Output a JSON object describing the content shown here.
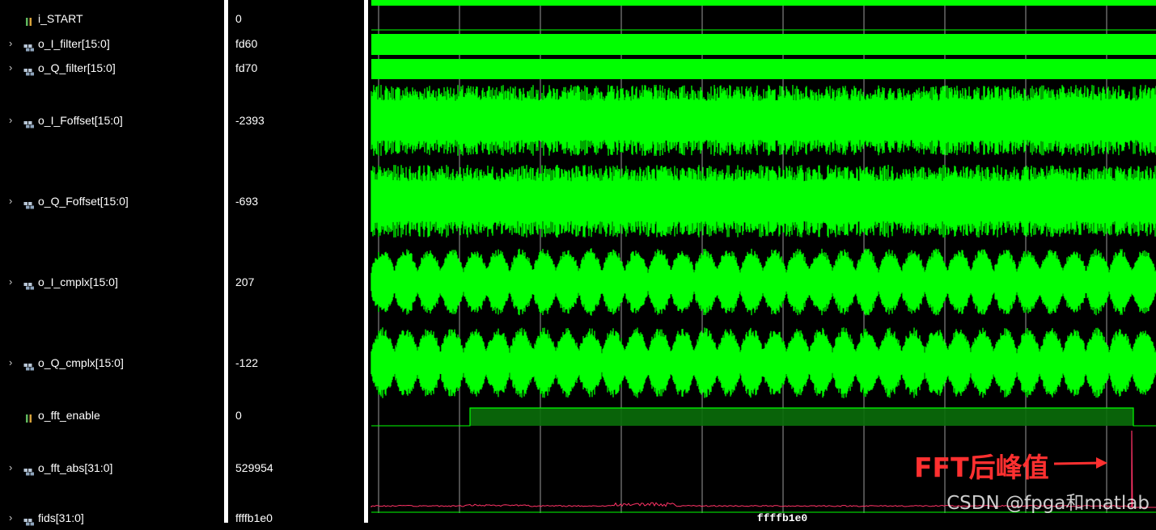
{
  "signals": [
    {
      "name": "i_START",
      "value": "0",
      "kind": "bit",
      "expandable": false
    },
    {
      "name": "o_I_filter[15:0]",
      "value": "fd60",
      "kind": "bus",
      "expandable": true
    },
    {
      "name": "o_Q_filter[15:0]",
      "value": "fd70",
      "kind": "bus",
      "expandable": true
    },
    {
      "name": "o_I_Foffset[15:0]",
      "value": "-2393",
      "kind": "bus",
      "expandable": true
    },
    {
      "name": "o_Q_Foffset[15:0]",
      "value": "-693",
      "kind": "bus",
      "expandable": true
    },
    {
      "name": "o_I_cmplx[15:0]",
      "value": "207",
      "kind": "bus",
      "expandable": true
    },
    {
      "name": "o_Q_cmplx[15:0]",
      "value": "-122",
      "kind": "bus",
      "expandable": true
    },
    {
      "name": "o_fft_enable",
      "value": "0",
      "kind": "bit",
      "expandable": false
    },
    {
      "name": "o_fft_abs[31:0]",
      "value": "529954",
      "kind": "bus",
      "expandable": true
    },
    {
      "name": "fids[31:0]",
      "value": "ffffb1e0",
      "kind": "bus",
      "expandable": true
    }
  ],
  "bus_value_label": "ffffb1e0",
  "annotation": {
    "text": "FFT后峰值"
  },
  "watermark": "CSDN @fpga和matlab",
  "colors": {
    "waveform": "#00ff00",
    "fft_spectrum": "#ff3366",
    "annotation": "#ff3030",
    "grid": "#9a9a9a",
    "enable_fill": "#0a6e0a"
  }
}
